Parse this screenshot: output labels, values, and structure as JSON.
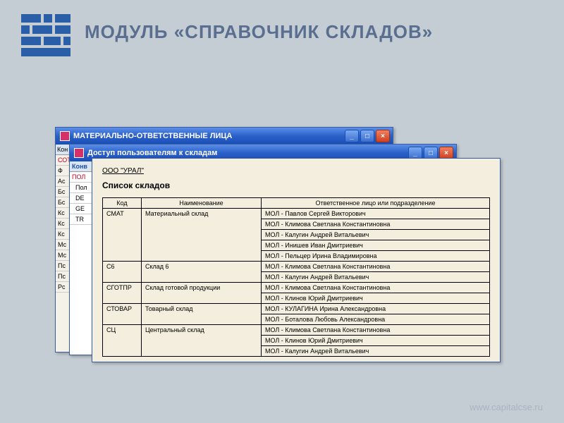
{
  "pageTitle": "МОДУЛЬ «СПРАВОЧНИК СКЛАДОВ»",
  "footer": "www.capitalcse.ru",
  "win1": {
    "title": "МАТЕРИАЛЬНО-ОТВЕТСТВЕННЫЕ ЛИЦА",
    "sideHeader": "Кон",
    "rows": [
      "СОТ",
      "Ф",
      "Ас",
      "Бс",
      "Бс",
      "Кс",
      "Кс",
      "Кс",
      "Мс",
      "Мс",
      "Пс",
      "Пс",
      "Рс"
    ]
  },
  "win2": {
    "title": "Доступ пользователям к складам",
    "sideHeader": "Конв",
    "rowRed": "ПОЛ",
    "rowSub": "Пол",
    "rows": [
      "DE",
      "GE",
      "TR"
    ]
  },
  "win3": {
    "org": "ООО \"УРАЛ\"",
    "reportTitle": "Список складов",
    "headers": {
      "code": "Код",
      "name": "Наименование",
      "resp": "Ответственное лицо или подразделение"
    },
    "rows": [
      {
        "code": "СМАТ",
        "name": "Материальный склад",
        "resp": [
          "МОЛ - Павлов Сергей Викторович",
          "МОЛ - Климова Светлана Константиновна",
          "МОЛ - Калугин Андрей Витальевич",
          "МОЛ - Инишев Иван Дмитриевич",
          "МОЛ - Пельцер Ирина Владимировна"
        ]
      },
      {
        "code": "С6",
        "name": "Склад 6",
        "resp": [
          "МОЛ - Климова Светлана Константиновна",
          "МОЛ - Калугин Андрей Витальевич"
        ]
      },
      {
        "code": "СГОТПР",
        "name": "Склад готовой продукции",
        "resp": [
          "МОЛ - Климова Светлана Константиновна",
          "МОЛ - Клинов Юрий Дмитриевич"
        ]
      },
      {
        "code": "СТОВАР",
        "name": "Товарный склад",
        "resp": [
          "МОЛ - КУЛАГИНА Ирина Александровна",
          "МОЛ - Боталова Любовь Александровна"
        ]
      },
      {
        "code": "СЦ",
        "name": "Центральный склад",
        "resp": [
          "МОЛ - Климова Светлана Константиновна",
          "МОЛ - Клинов Юрий Дмитриевич",
          "МОЛ - Калугин Андрей Витальевич"
        ]
      }
    ]
  },
  "winbtns": {
    "min": "_",
    "max": "□",
    "close": "×"
  }
}
